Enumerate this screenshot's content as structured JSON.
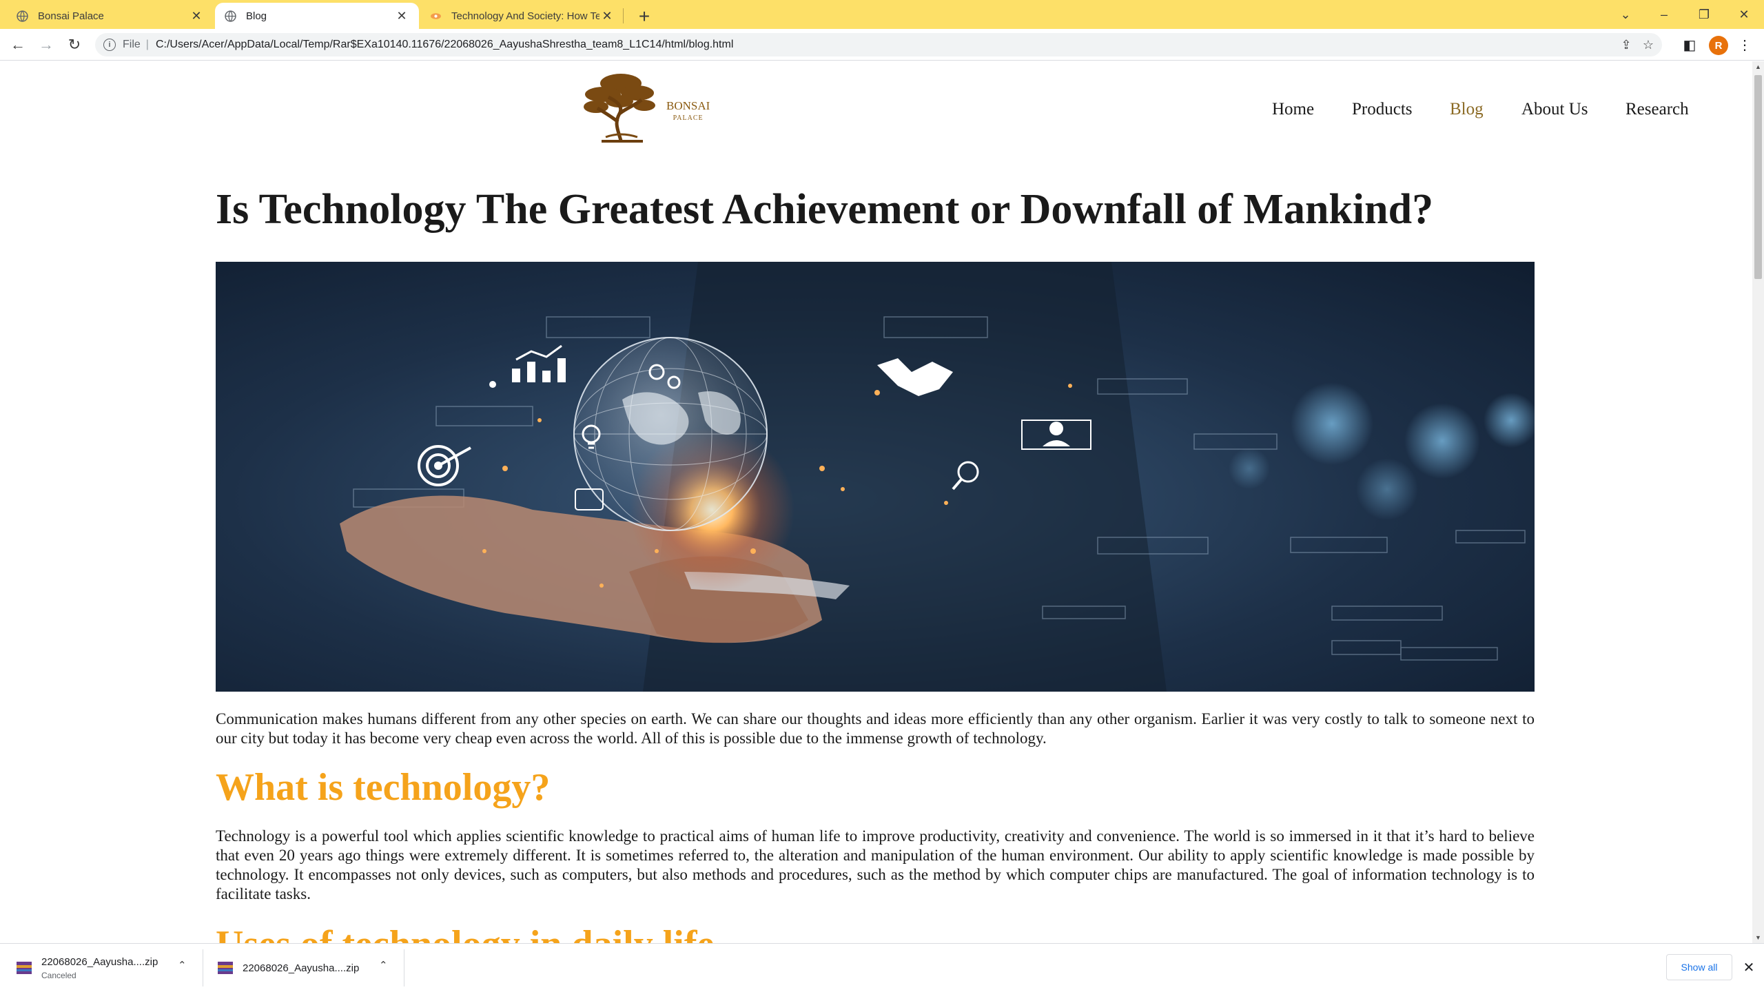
{
  "browser": {
    "tabs": [
      {
        "title": "Bonsai Palace",
        "icon": "globe-icon"
      },
      {
        "title": "Blog",
        "icon": "globe-icon"
      },
      {
        "title": "Technology And Society: How Te",
        "icon": "site-favicon"
      }
    ],
    "address": {
      "scheme": "File",
      "url": "C:/Users/Acer/AppData/Local/Temp/Rar$EXa10140.11676/22068026_AayushaShrestha_team8_L1C14/html/blog.html"
    },
    "profile_initial": "R",
    "accent": "#fde068"
  },
  "site": {
    "logo": {
      "name": "BONSAI",
      "sub": "PALACE"
    },
    "nav": [
      "Home",
      "Products",
      "Blog",
      "About Us",
      "Research"
    ],
    "active_nav": "Blog"
  },
  "article": {
    "title": "Is Technology The Greatest Achievement or Downfall of Mankind?",
    "intro": "Communication makes humans different from any other species on earth. We can share our thoughts and ideas more efficiently than any other organism. Earlier it was very costly to talk to someone next to our city but today it has become very cheap even across the world. All of this is possible due to the immense growth of technology.",
    "h2_what": "What is technology?",
    "body_what": "Technology is a powerful tool which applies scientific knowledge to practical aims of human life to improve productivity, creativity and convenience. The world is so immersed in it that it’s hard to believe that even 20 years ago things were extremely different. It is sometimes referred to, the alteration and manipulation of the human environment. Our ability to apply scientific knowledge is made possible by technology. It encompasses not only devices, such as computers, but also methods and procedures, such as the method by which computer chips are manufactured. The goal of information technology is to facilitate tasks.",
    "h2_uses": "Uses of technology in daily life",
    "heading_color": "#f5a31b"
  },
  "downloads": {
    "items": [
      {
        "name": "22068026_Aayusha....zip",
        "status": "Canceled"
      },
      {
        "name": "22068026_Aayusha....zip",
        "status": ""
      }
    ],
    "show_all": "Show all"
  }
}
